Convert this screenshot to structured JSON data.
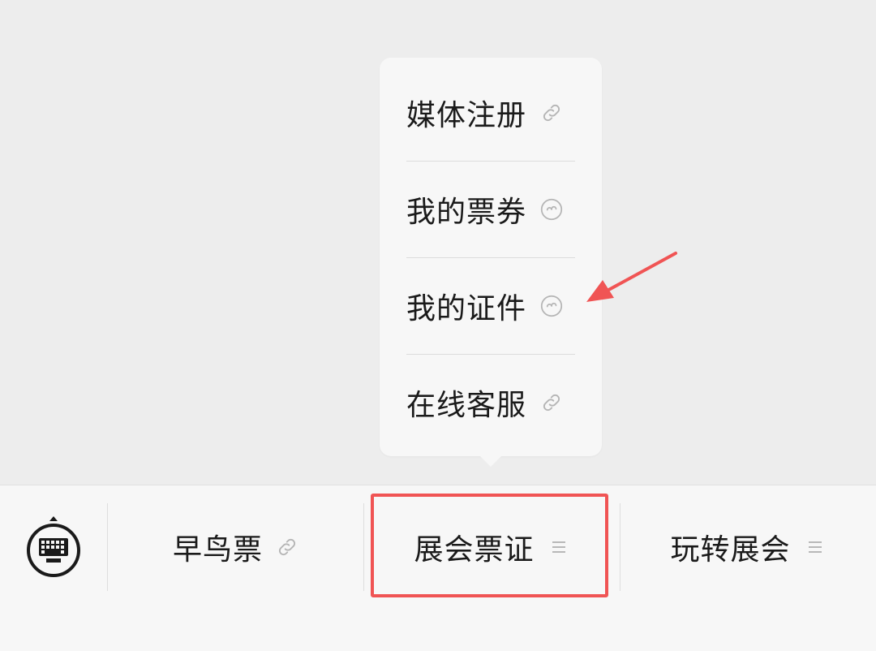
{
  "popup_menu": {
    "items": [
      {
        "label": "媒体注册",
        "icon": "link-icon"
      },
      {
        "label": "我的票券",
        "icon": "mini-program-icon"
      },
      {
        "label": "我的证件",
        "icon": "mini-program-icon"
      },
      {
        "label": "在线客服",
        "icon": "link-icon"
      }
    ]
  },
  "bottom_bar": {
    "keyboard_icon": "keyboard-toggle-icon",
    "tabs": [
      {
        "label": "早鸟票",
        "icon": "link-icon"
      },
      {
        "label": "展会票证",
        "icon": "menu-icon"
      },
      {
        "label": "玩转展会",
        "icon": "menu-icon"
      }
    ]
  },
  "annotation": {
    "highlight_color": "#f05454",
    "arrow_color": "#f05454"
  },
  "colors": {
    "background": "#ededed",
    "panel": "#f7f7f7",
    "text": "#1a1a1a",
    "icon_gray": "#b0b0b0"
  }
}
